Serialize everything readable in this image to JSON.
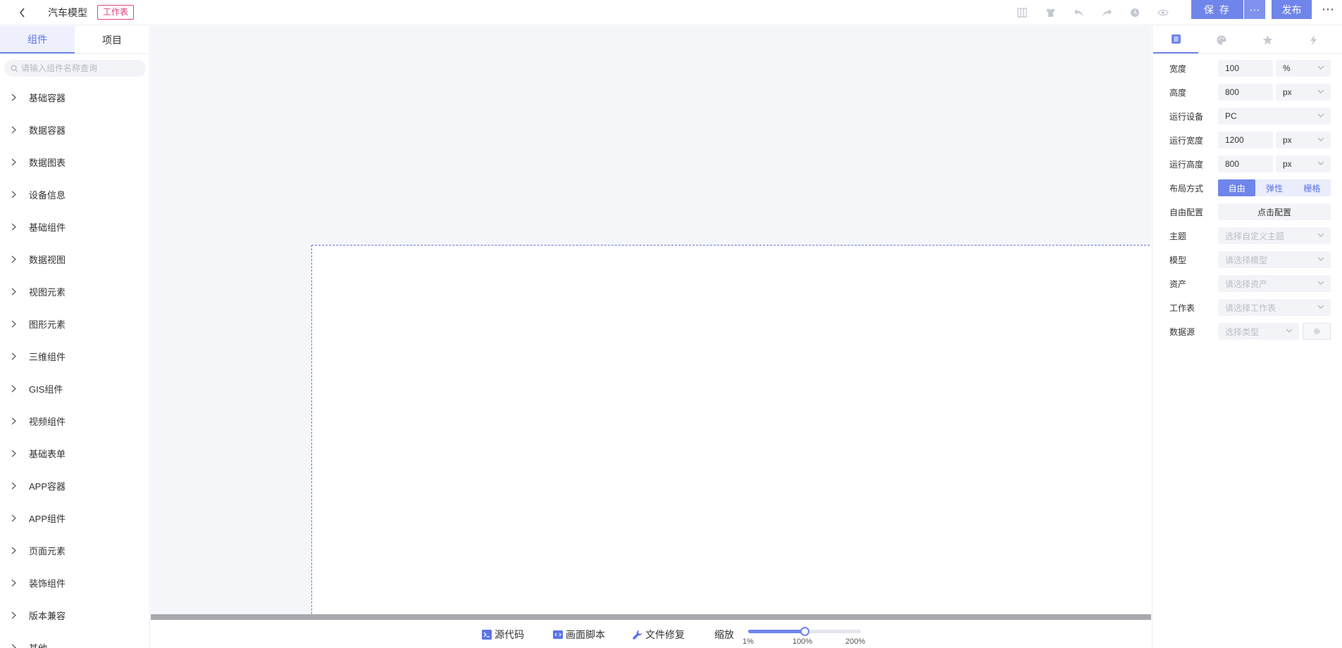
{
  "header": {
    "title": "汽车模型",
    "badge": "工作表",
    "save_label": "保 存",
    "more_label": "⋯",
    "publish_label": "发布",
    "kebab_label": "⋯",
    "icons": [
      "grid-icon",
      "shirt-icon",
      "undo-icon",
      "redo-icon",
      "history-icon",
      "eye-icon"
    ]
  },
  "left": {
    "tabs": [
      {
        "label": "组件"
      },
      {
        "label": "项目"
      }
    ],
    "search_placeholder": "请输入组件名称查询",
    "categories": [
      {
        "label": "基础容器"
      },
      {
        "label": "数据容器"
      },
      {
        "label": "数据图表"
      },
      {
        "label": "设备信息"
      },
      {
        "label": "基础组件"
      },
      {
        "label": "数据视图"
      },
      {
        "label": "视图元素"
      },
      {
        "label": "图形元素"
      },
      {
        "label": "三维组件"
      },
      {
        "label": "GIS组件"
      },
      {
        "label": "视频组件"
      },
      {
        "label": "基础表单"
      },
      {
        "label": "APP容器"
      },
      {
        "label": "APP组件"
      },
      {
        "label": "页面元素"
      },
      {
        "label": "装饰组件"
      },
      {
        "label": "版本兼容"
      },
      {
        "label": "其他"
      }
    ]
  },
  "bottom": {
    "source_code": "源代码",
    "canvas_script": "画面脚本",
    "file_repair": "文件修复",
    "zoom_label": "缩放",
    "zoom_value": 0.5,
    "zoom_ticks": [
      "1%",
      "100%",
      "200%"
    ]
  },
  "right": {
    "tab_icons": [
      "list-icon",
      "palette-icon",
      "star-icon",
      "bolt-icon"
    ],
    "props": {
      "width": {
        "label": "宽度",
        "value": "100",
        "unit": "%"
      },
      "height": {
        "label": "高度",
        "value": "800",
        "unit": "px"
      },
      "device": {
        "label": "运行设备",
        "value": "PC"
      },
      "run_width": {
        "label": "运行宽度",
        "value": "1200",
        "unit": "px"
      },
      "run_height": {
        "label": "运行高度",
        "value": "800",
        "unit": "px"
      },
      "layout": {
        "label": "布局方式",
        "options": [
          "自由",
          "弹性",
          "栅格"
        ],
        "selected": "自由"
      },
      "free_config": {
        "label": "自由配置",
        "button": "点击配置"
      },
      "theme": {
        "label": "主题",
        "placeholder": "选择自定义主题"
      },
      "model": {
        "label": "模型",
        "placeholder": "请选择模型"
      },
      "asset": {
        "label": "资产",
        "placeholder": "请选择资产"
      },
      "worksheet": {
        "label": "工作表",
        "placeholder": "请选择工作表"
      },
      "datasource": {
        "label": "数据源",
        "placeholder": "选择类型"
      }
    }
  },
  "colors": {
    "accent": "#6f85ea",
    "badge": "#e0407b",
    "canvas_bg": "#f5f6f9"
  }
}
